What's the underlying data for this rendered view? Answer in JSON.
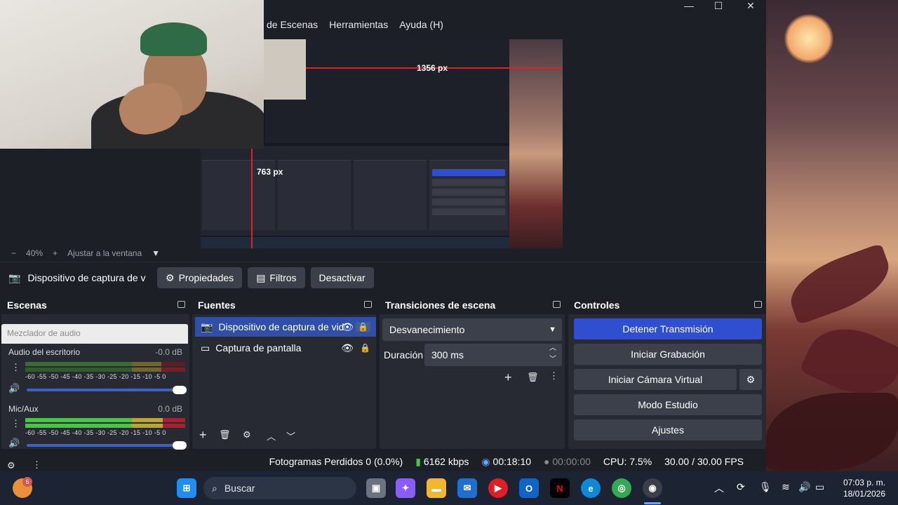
{
  "window": {
    "menu": [
      "de Escenas",
      "Herramientas",
      "Ayuda (H)"
    ],
    "controls": {
      "minimize": "—",
      "maximize": "☐",
      "close": "✕"
    }
  },
  "preview": {
    "width_label": "1356 px",
    "height_label": "763 px",
    "zoom": "40%",
    "zoom_minus": "−",
    "zoom_plus": "+",
    "fit_label": "Ajustar a la ventana"
  },
  "source_toolbar": {
    "selected_source": "Dispositivo de captura de v",
    "properties": "Propiedades",
    "filters": "Filtros",
    "deactivate": "Desactivar"
  },
  "scenes": {
    "title": "Escenas"
  },
  "mixer": {
    "title": "Mezclador de audio",
    "scale": "-60 -55 -50 -45 -40 -35 -30 -25 -20 -15 -10 -5 0",
    "channels": [
      {
        "name": "Audio del escritorio",
        "db": "-0.0 dB",
        "level": 0.84,
        "volume": 1.0
      },
      {
        "name": "Mic/Aux",
        "db": "0.0 dB",
        "level": 0.87,
        "volume": 1.0
      }
    ]
  },
  "sources": {
    "title": "Fuentes",
    "items": [
      {
        "label": "Dispositivo de captura de vid",
        "selected": true
      },
      {
        "label": "Captura de pantalla",
        "selected": false
      }
    ]
  },
  "transitions": {
    "title": "Transiciones de escena",
    "selected": "Desvanecimiento",
    "duration_label": "Duración",
    "duration_value": "300 ms"
  },
  "controls": {
    "title": "Controles",
    "stop_stream": "Detener Transmisión",
    "start_recording": "Iniciar Grabación",
    "start_virtual_cam": "Iniciar Cámara Virtual",
    "studio_mode": "Modo Estudio",
    "settings": "Ajustes"
  },
  "status": {
    "dropped_frames": "Fotogramas Perdidos 0 (0.0%)",
    "bitrate": "6162 kbps",
    "stream_time": "00:18:10",
    "record_time": "00:00:00",
    "cpu": "CPU: 7.5%",
    "fps": "30.00 / 30.00 FPS"
  },
  "taskbar": {
    "search_placeholder": "Buscar",
    "notification_badge": "6",
    "time": "07:03 p. m.",
    "date": "18/01/2026"
  },
  "colors": {
    "accent": "#2f4fd0",
    "selection": "#2f4fa8",
    "dock_bg": "#272a33",
    "window_bg": "#1d1f26"
  }
}
